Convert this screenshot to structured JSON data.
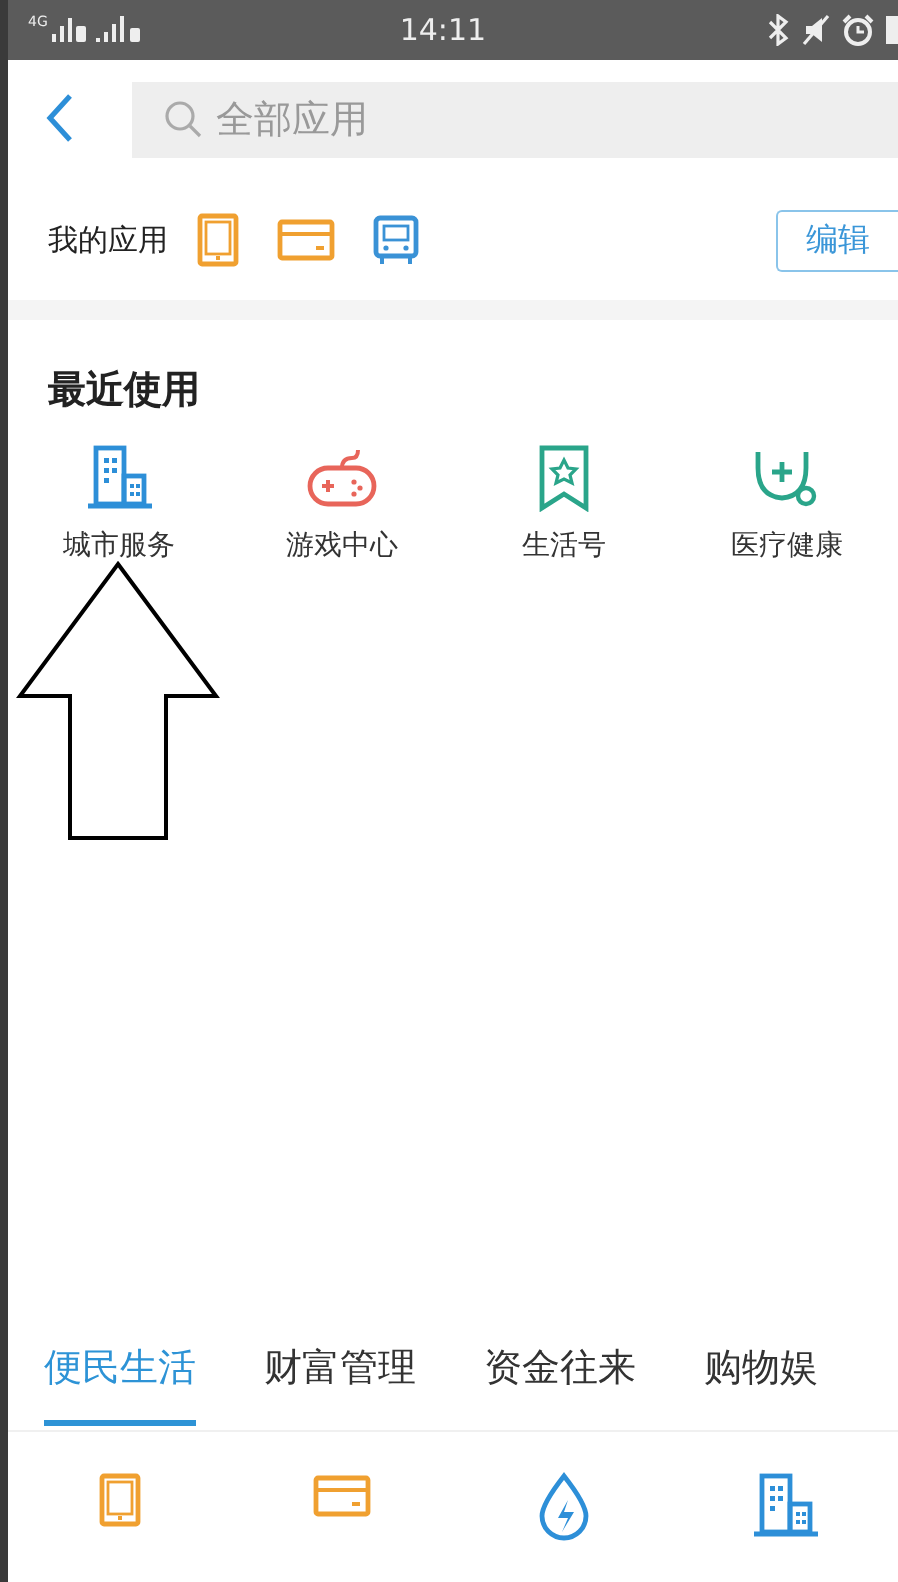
{
  "status_bar": {
    "network": "4G",
    "time": "14:11"
  },
  "search": {
    "placeholder": "全部应用"
  },
  "my_apps": {
    "label": "我的应用",
    "icons": [
      {
        "kind": "tablet"
      },
      {
        "kind": "card"
      },
      {
        "kind": "bus"
      }
    ],
    "edit_button": "编辑"
  },
  "recent": {
    "title": "最近使用",
    "items": [
      {
        "label": "城市服务",
        "kind": "building"
      },
      {
        "label": "游戏中心",
        "kind": "gamepad"
      },
      {
        "label": "生活号",
        "kind": "bookmark"
      },
      {
        "label": "医疗健康",
        "kind": "stethoscope"
      }
    ]
  },
  "annotation": {
    "kind": "arrow"
  },
  "tabs": [
    {
      "label": "便民生活",
      "selected": true
    },
    {
      "label": "财富管理",
      "selected": false
    },
    {
      "label": "资金往来",
      "selected": false
    },
    {
      "label": "购物娱",
      "selected": false
    }
  ],
  "grid_icons": [
    {
      "kind": "tablet"
    },
    {
      "kind": "card"
    },
    {
      "kind": "drop"
    },
    {
      "kind": "building"
    }
  ]
}
